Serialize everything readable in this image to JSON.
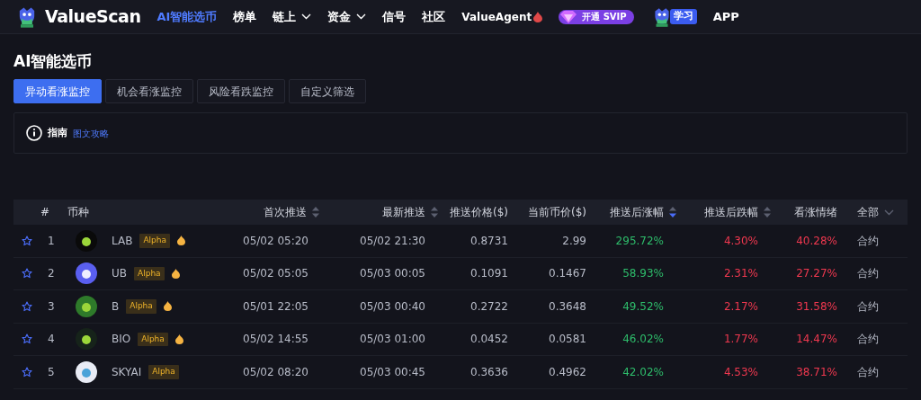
{
  "nav": {
    "brand": "ValueScan",
    "items": [
      {
        "label": "AI智能选币",
        "kind": "link",
        "selected": true
      },
      {
        "label": "榜单",
        "kind": "link",
        "selected": false
      },
      {
        "label": "链上",
        "kind": "menu",
        "selected": false
      },
      {
        "label": "资金",
        "kind": "menu",
        "selected": false
      },
      {
        "label": "信号",
        "kind": "link",
        "selected": false
      },
      {
        "label": "社区",
        "kind": "link",
        "selected": false
      },
      {
        "label": "ValueAgent",
        "kind": "agent",
        "selected": false
      },
      {
        "label": "开通 SVIP",
        "kind": "vip",
        "selected": false
      },
      {
        "label": "学习",
        "kind": "learn",
        "selected": false
      },
      {
        "label": "APP",
        "kind": "link",
        "selected": false
      }
    ]
  },
  "page": {
    "title": "AI智能选币",
    "tabs": [
      {
        "label": "异动看涨监控",
        "selected": true
      },
      {
        "label": "机会看涨监控",
        "selected": false
      },
      {
        "label": "风险看跌监控",
        "selected": false
      },
      {
        "label": "自定义筛选",
        "selected": false
      }
    ],
    "guide": {
      "label": "指南",
      "link": "图文攻略"
    }
  },
  "table": {
    "columns": [
      {
        "label": "#",
        "kind": "plain"
      },
      {
        "label": "币种",
        "kind": "plain"
      },
      {
        "label": "首次推送",
        "kind": "sort",
        "active": false
      },
      {
        "label": "最新推送",
        "kind": "sort",
        "active": false
      },
      {
        "label": "推送价格($)",
        "kind": "plain"
      },
      {
        "label": "当前币价($)",
        "kind": "plain"
      },
      {
        "label": "推送后涨幅",
        "kind": "sort",
        "active": true
      },
      {
        "label": "推送后跌幅",
        "kind": "sort",
        "active": false
      },
      {
        "label": "看涨情绪",
        "kind": "plain"
      },
      {
        "label": "全部",
        "kind": "dropdown"
      }
    ],
    "rows": [
      {
        "rank": "1",
        "symbol": "LAB",
        "badge": "Alpha",
        "hot": true,
        "first": "05/02 05:20",
        "latest": "05/02 21:30",
        "push_price": "0.8731",
        "price": "2.99",
        "rise": "295.72%",
        "fall": "4.30%",
        "sentiment": "40.28%",
        "type": "合约"
      },
      {
        "rank": "2",
        "symbol": "UB",
        "badge": "Alpha",
        "hot": true,
        "first": "05/02 05:05",
        "latest": "05/03 00:05",
        "push_price": "0.1091",
        "price": "0.1467",
        "rise": "58.93%",
        "fall": "2.31%",
        "sentiment": "27.27%",
        "type": "合约"
      },
      {
        "rank": "3",
        "symbol": "B",
        "badge": "Alpha",
        "hot": true,
        "first": "05/01 22:05",
        "latest": "05/03 00:40",
        "push_price": "0.2722",
        "price": "0.3648",
        "rise": "49.52%",
        "fall": "2.17%",
        "sentiment": "31.58%",
        "type": "合约"
      },
      {
        "rank": "4",
        "symbol": "BIO",
        "badge": "Alpha",
        "hot": true,
        "first": "05/02 14:55",
        "latest": "05/03 01:00",
        "push_price": "0.0452",
        "price": "0.0581",
        "rise": "46.02%",
        "fall": "1.77%",
        "sentiment": "14.47%",
        "type": "合约"
      },
      {
        "rank": "5",
        "symbol": "SKYAI",
        "badge": "Alpha",
        "hot": false,
        "first": "05/02 08:20",
        "latest": "05/03 00:45",
        "push_price": "0.3636",
        "price": "0.4962",
        "rise": "42.02%",
        "fall": "4.53%",
        "sentiment": "38.71%",
        "type": "合约"
      }
    ]
  }
}
